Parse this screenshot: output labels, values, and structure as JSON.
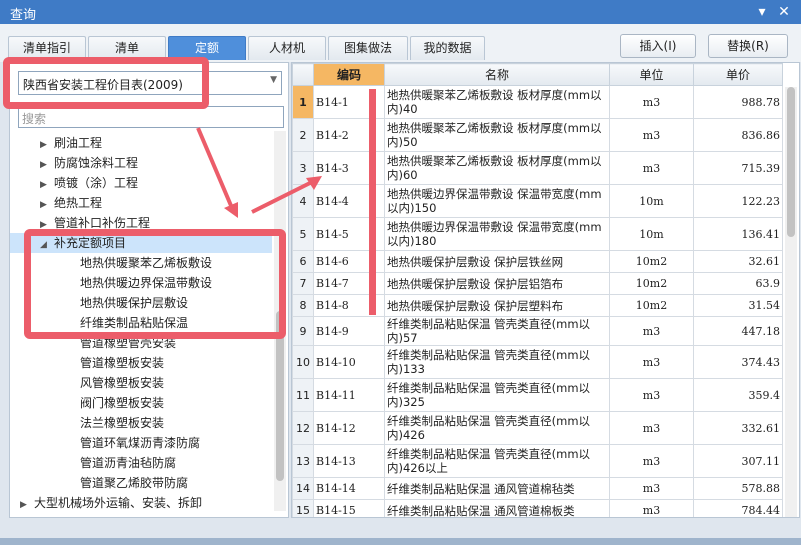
{
  "window": {
    "title": "查询"
  },
  "tabs": [
    {
      "label": "清单指引"
    },
    {
      "label": "清单"
    },
    {
      "label": "定额"
    },
    {
      "label": "人材机"
    },
    {
      "label": "图集做法"
    },
    {
      "label": "我的数据"
    }
  ],
  "actions": {
    "insert": "插入(I)",
    "replace": "替换(R)"
  },
  "library": {
    "selected": "陕西省安装工程价目表(2009)"
  },
  "search": {
    "placeholder": "搜索"
  },
  "tree": [
    {
      "label": "刷油工程"
    },
    {
      "label": "防腐蚀涂料工程"
    },
    {
      "label": "喷镀（涂）工程"
    },
    {
      "label": "绝热工程"
    },
    {
      "label": "管道补口补伤工程"
    },
    {
      "label": "补充定额项目"
    },
    {
      "label": "地热供暖聚苯乙烯板敷设"
    },
    {
      "label": "地热供暖边界保温带敷设"
    },
    {
      "label": "地热供暖保护层敷设"
    },
    {
      "label": "纤维类制品粘贴保温"
    },
    {
      "label": "管道橡塑管壳安装"
    },
    {
      "label": "管道橡塑板安装"
    },
    {
      "label": "风管橡塑板安装"
    },
    {
      "label": "阀门橡塑板安装"
    },
    {
      "label": "法兰橡塑板安装"
    },
    {
      "label": "管道环氧煤沥青漆防腐"
    },
    {
      "label": "管道沥青油毡防腐"
    },
    {
      "label": "管道聚乙烯胶带防腐"
    },
    {
      "label": "大型机械场外运输、安装、拆卸"
    }
  ],
  "table": {
    "headers": {
      "code": "编码",
      "name": "名称",
      "unit": "单位",
      "price": "单价"
    },
    "rows": [
      {
        "idx": "1",
        "code": "B14-1",
        "name": "地热供暖聚苯乙烯板敷设 板材厚度(mm以内)40",
        "unit": "m3",
        "price": "988.78"
      },
      {
        "idx": "2",
        "code": "B14-2",
        "name": "地热供暖聚苯乙烯板敷设 板材厚度(mm以内)50",
        "unit": "m3",
        "price": "836.86"
      },
      {
        "idx": "3",
        "code": "B14-3",
        "name": "地热供暖聚苯乙烯板敷设 板材厚度(mm以内)60",
        "unit": "m3",
        "price": "715.39"
      },
      {
        "idx": "4",
        "code": "B14-4",
        "name": "地热供暖边界保温带敷设 保温带宽度(mm以内)150",
        "unit": "10m",
        "price": "122.23"
      },
      {
        "idx": "5",
        "code": "B14-5",
        "name": "地热供暖边界保温带敷设 保温带宽度(mm以内)180",
        "unit": "10m",
        "price": "136.41"
      },
      {
        "idx": "6",
        "code": "B14-6",
        "name": "地热供暖保护层敷设 保护层铁丝网",
        "unit": "10m2",
        "price": "32.61"
      },
      {
        "idx": "7",
        "code": "B14-7",
        "name": "地热供暖保护层敷设 保护层铝箔布",
        "unit": "10m2",
        "price": "63.9"
      },
      {
        "idx": "8",
        "code": "B14-8",
        "name": "地热供暖保护层敷设 保护层塑料布",
        "unit": "10m2",
        "price": "31.54"
      },
      {
        "idx": "9",
        "code": "B14-9",
        "name": "纤维类制品粘贴保温 管壳类直径(mm以内)57",
        "unit": "m3",
        "price": "447.18"
      },
      {
        "idx": "10",
        "code": "B14-10",
        "name": "纤维类制品粘贴保温 管壳类直径(mm以内)133",
        "unit": "m3",
        "price": "374.43"
      },
      {
        "idx": "11",
        "code": "B14-11",
        "name": "纤维类制品粘贴保温 管壳类直径(mm以内)325",
        "unit": "m3",
        "price": "359.4"
      },
      {
        "idx": "12",
        "code": "B14-12",
        "name": "纤维类制品粘贴保温 管壳类直径(mm以内)426",
        "unit": "m3",
        "price": "332.61"
      },
      {
        "idx": "13",
        "code": "B14-13",
        "name": "纤维类制品粘贴保温 管壳类直径(mm以内)426以上",
        "unit": "m3",
        "price": "307.11"
      },
      {
        "idx": "14",
        "code": "B14-14",
        "name": "纤维类制品粘贴保温 通风管道棉毡类",
        "unit": "m3",
        "price": "578.88"
      },
      {
        "idx": "15",
        "code": "B14-15",
        "name": "纤维类制品粘贴保温 通风管道棉板类",
        "unit": "m3",
        "price": "784.44"
      }
    ]
  },
  "colors": {
    "accent": "#3f7bc6",
    "annotation": "#ec5d6a",
    "highlight": "#f5b763"
  }
}
